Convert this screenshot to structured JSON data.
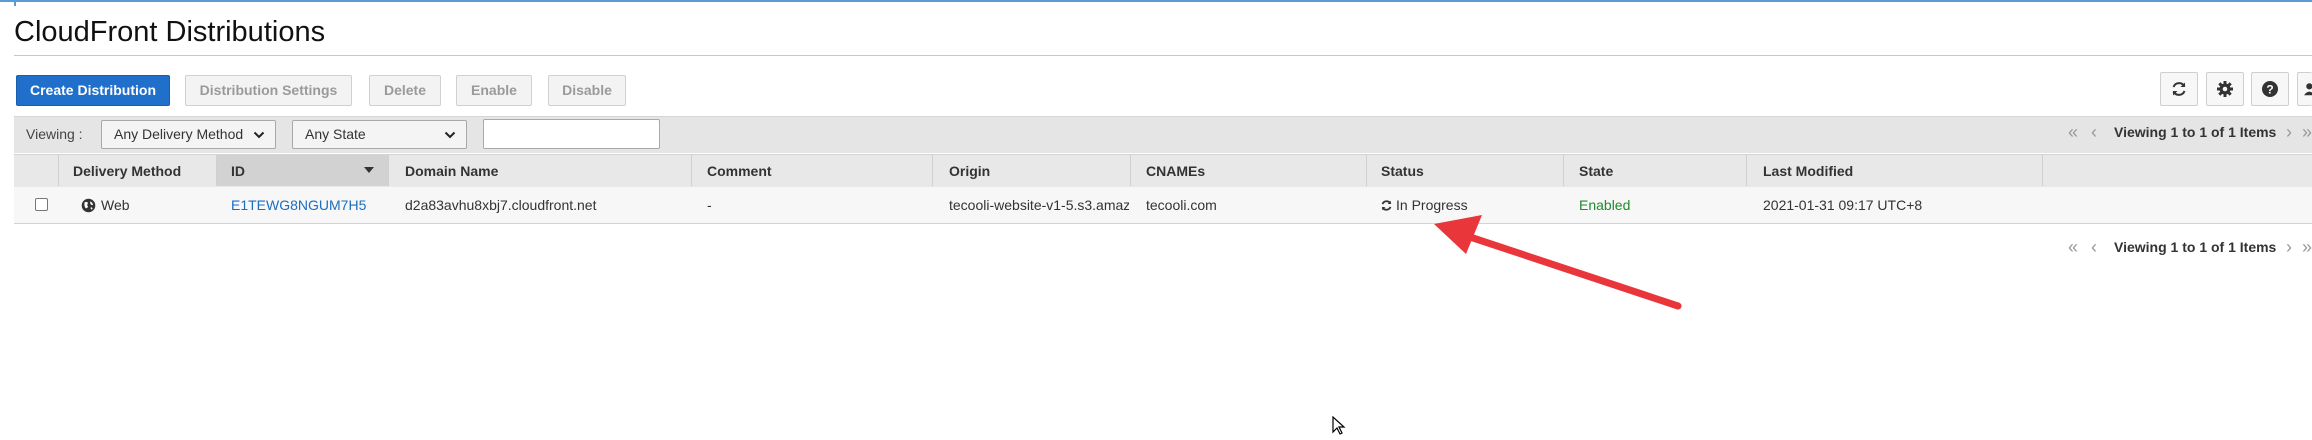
{
  "page": {
    "title": "CloudFront Distributions"
  },
  "toolbar": {
    "create_label": "Create Distribution",
    "settings_label": "Distribution Settings",
    "delete_label": "Delete",
    "enable_label": "Enable",
    "disable_label": "Disable",
    "icons": [
      "refresh-icon",
      "gear-icon",
      "help-icon",
      "user-icon"
    ]
  },
  "filter": {
    "viewing_label": "Viewing :",
    "delivery_method": "Any Delivery Method",
    "state": "Any State",
    "search_value": ""
  },
  "pagination": {
    "text": "Viewing 1 to 1 of 1 Items"
  },
  "table": {
    "columns": [
      "Delivery Method",
      "ID",
      "Domain Name",
      "Comment",
      "Origin",
      "CNAMEs",
      "Status",
      "State",
      "Last Modified"
    ],
    "rows": [
      {
        "delivery_method": "Web",
        "id": "E1TEWG8NGUM7H5",
        "domain_name": "d2a83avhu8xbj7.cloudfront.net",
        "comment": "-",
        "origin": "tecooli-website-v1-5.s3.amaz",
        "cnames": "tecooli.com",
        "status": "In Progress",
        "state": "Enabled",
        "last_modified": "2021-01-31 09:17 UTC+8"
      }
    ]
  },
  "colors": {
    "primary": "#1f6fcb",
    "link": "#1a6ec0",
    "enabled": "#1f8a2e",
    "annotation_arrow": "#e8363b"
  }
}
